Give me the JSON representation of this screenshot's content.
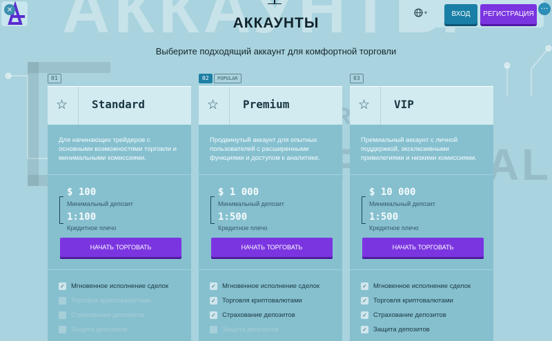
{
  "header": {
    "page_title": "АККАУНТЫ",
    "login_label": "ВХОД",
    "register_label": "РЕГИСТРАЦИЯ",
    "subtitle": "Выберите подходящий аккаунт для комфортной торговли"
  },
  "overlay": {
    "close_glyph": "×",
    "more_glyph": "…"
  },
  "watermark": {
    "word_1": "BROKER",
    "word_2": "TRIBUNAL"
  },
  "cards": [
    {
      "number": "01",
      "badge": "",
      "name": "Standard",
      "description": "Для начинающих трейдеров с основными возможностями торговли и минимальными комиссиями.",
      "deposit": "$ 100",
      "deposit_label": "Минимальный депозит",
      "leverage": "1:100",
      "leverage_label": "Кредитное плечо",
      "cta": "НАЧАТЬ ТОРГОВАТЬ",
      "features": [
        {
          "label": "Мгновенное исполнение сделок",
          "enabled": true
        },
        {
          "label": "Торговля криптовалютами",
          "enabled": false
        },
        {
          "label": "Страхование депозитов",
          "enabled": false
        },
        {
          "label": "Защита депозитов",
          "enabled": false
        }
      ]
    },
    {
      "number": "02",
      "badge": "POPULAR",
      "name": "Premium",
      "description": "Продвинутый аккаунт для опытных пользователей с расширенными функциями и доступом к аналитике.",
      "deposit": "$ 1 000",
      "deposit_label": "Минимальный депозит",
      "leverage": "1:500",
      "leverage_label": "Кредитное плечо",
      "cta": "НАЧАТЬ ТОРГОВАТЬ",
      "features": [
        {
          "label": "Мгновенное исполнение сделок",
          "enabled": true
        },
        {
          "label": "Торговля криптовалютами",
          "enabled": true
        },
        {
          "label": "Страхование депозитов",
          "enabled": true
        },
        {
          "label": "Защита депозитов",
          "enabled": false
        }
      ]
    },
    {
      "number": "03",
      "badge": "",
      "name": "VIP",
      "description": "Премиальный аккаунт с личной поддержкой, эксклюзивными привилегиями и низкими комиссиями.",
      "deposit": "$ 10 000",
      "deposit_label": "Минимальный депозит",
      "leverage": "1:500",
      "leverage_label": "Кредитное плечо",
      "cta": "НАЧАТЬ ТОРГОВАТЬ",
      "features": [
        {
          "label": "Мгновенное исполнение сделок",
          "enabled": true
        },
        {
          "label": "Торговля криптовалютами",
          "enabled": true
        },
        {
          "label": "Страхование депозитов",
          "enabled": true
        },
        {
          "label": "Защита депозитов",
          "enabled": true
        }
      ]
    }
  ],
  "colors": {
    "background": "#a9d3de",
    "accent_purple": "#7b35e0",
    "accent_blue": "#1a7fa6"
  }
}
